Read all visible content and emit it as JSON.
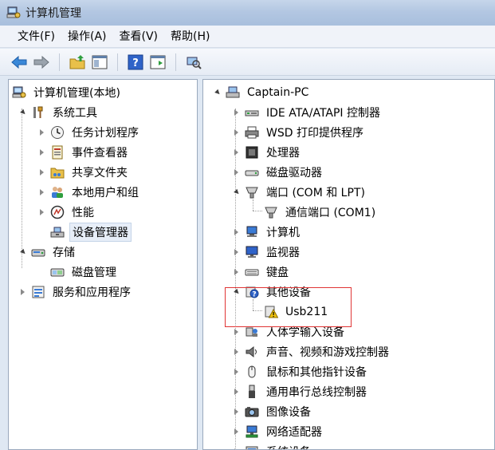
{
  "window": {
    "title": "计算机管理"
  },
  "menu": [
    "文件(F)",
    "操作(A)",
    "查看(V)",
    "帮助(H)"
  ],
  "toolbar": [
    "back-icon",
    "forward-icon",
    "up-folder-icon",
    "show-hide-tree-icon",
    "help-icon",
    "action-pane-icon",
    "scan-hardware-icon"
  ],
  "left_tree": [
    {
      "label": "计算机管理(本地)",
      "icon": "computer-management-icon"
    },
    {
      "label": "系统工具",
      "icon": "tools-icon"
    },
    {
      "label": "任务计划程序",
      "icon": "clock-icon"
    },
    {
      "label": "事件查看器",
      "icon": "event-viewer-icon"
    },
    {
      "label": "共享文件夹",
      "icon": "shared-folder-icon"
    },
    {
      "label": "本地用户和组",
      "icon": "users-icon"
    },
    {
      "label": "性能",
      "icon": "performance-icon"
    },
    {
      "label": "设备管理器",
      "icon": "device-manager-icon"
    },
    {
      "label": "存储",
      "icon": "storage-icon"
    },
    {
      "label": "磁盘管理",
      "icon": "disk-management-icon"
    },
    {
      "label": "服务和应用程序",
      "icon": "services-icon"
    }
  ],
  "right_tree": [
    {
      "label": "Captain-PC",
      "icon": "computer-icon"
    },
    {
      "label": "IDE ATA/ATAPI 控制器",
      "icon": "ide-controller-icon"
    },
    {
      "label": "WSD 打印提供程序",
      "icon": "printer-icon"
    },
    {
      "label": "处理器",
      "icon": "processor-icon"
    },
    {
      "label": "磁盘驱动器",
      "icon": "disk-drive-icon"
    },
    {
      "label": "端口 (COM 和 LPT)",
      "icon": "port-icon"
    },
    {
      "label": "通信端口 (COM1)",
      "icon": "port-icon"
    },
    {
      "label": "计算机",
      "icon": "computer-icon"
    },
    {
      "label": "监视器",
      "icon": "monitor-icon"
    },
    {
      "label": "键盘",
      "icon": "keyboard-icon"
    },
    {
      "label": "其他设备",
      "icon": "unknown-device-icon"
    },
    {
      "label": "Usb211",
      "icon": "warning-device-icon"
    },
    {
      "label": "人体学输入设备",
      "icon": "hid-icon"
    },
    {
      "label": "声音、视频和游戏控制器",
      "icon": "speaker-icon"
    },
    {
      "label": "鼠标和其他指针设备",
      "icon": "mouse-icon"
    },
    {
      "label": "通用串行总线控制器",
      "icon": "usb-icon"
    },
    {
      "label": "图像设备",
      "icon": "camera-icon"
    },
    {
      "label": "网络适配器",
      "icon": "network-adapter-icon"
    },
    {
      "label": "系统设备",
      "icon": "system-device-icon"
    }
  ]
}
